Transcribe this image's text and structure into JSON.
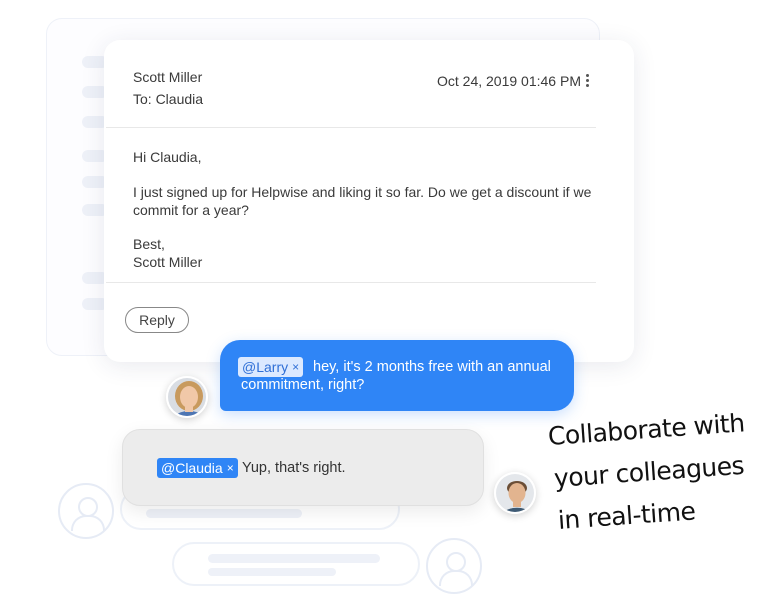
{
  "email": {
    "from": "Scott Miller",
    "to": "To: Claudia",
    "date": "Oct 24, 2019 01:46 PM",
    "greeting": "Hi Claudia,",
    "body_line1": "I just signed up for Helpwise and liking it so far. Do we get a discount if we",
    "body_line2": "commit for a year?",
    "signoff": "Best,",
    "signature": "Scott Miller",
    "reply_label": "Reply"
  },
  "chat": {
    "message1": {
      "mention": "@Larry",
      "remove_glyph": "×",
      "text_line1": "hey, it's 2 months free with an annual",
      "text_line2": "commitment, right?"
    },
    "message2": {
      "mention": "@Claudia",
      "remove_glyph": "×",
      "text": "Yup, that's right."
    }
  },
  "tagline": {
    "line1": "Collaborate with",
    "line2": "your colleagues",
    "line3": "in real-time"
  },
  "icons": {
    "more": "kebab-vertical-icon",
    "avatar_placeholder": "user-outline-icon"
  },
  "colors": {
    "accent_blue": "#2f85f6",
    "gray_bubble": "#ececec",
    "mention_chip_light": "#dbe9ff"
  }
}
